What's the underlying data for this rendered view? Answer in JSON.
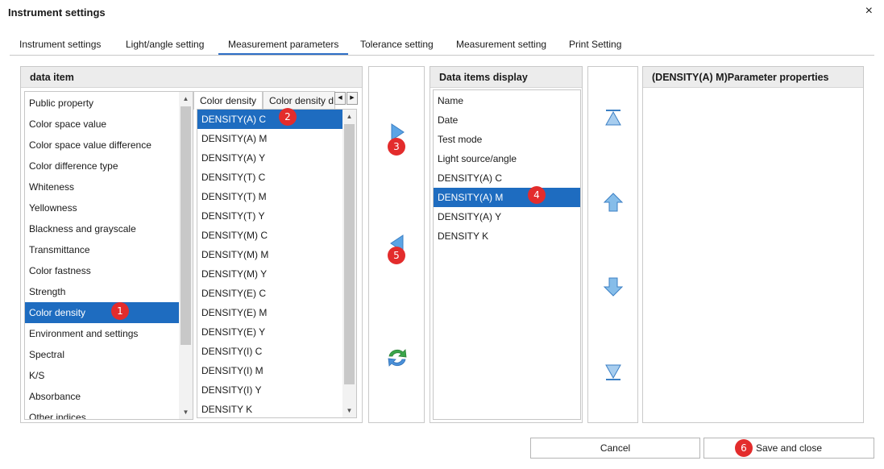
{
  "dialog": {
    "title": "Instrument settings",
    "close_glyph": "×"
  },
  "tabs": [
    {
      "label": "Instrument settings"
    },
    {
      "label": "Light/angle setting"
    },
    {
      "label": "Measurement parameters",
      "active": true
    },
    {
      "label": "Tolerance setting"
    },
    {
      "label": "Measurement setting"
    },
    {
      "label": "Print Setting"
    }
  ],
  "data_item": {
    "header": "data item",
    "categories": [
      "Public property",
      "Color space value",
      "Color space value difference",
      "Color difference type",
      "Whiteness",
      "Yellowness",
      "Blackness and grayscale",
      "Transmittance",
      "Color fastness",
      "Strength",
      "Color density",
      "Environment and settings",
      "Spectral",
      "K/S",
      "Absorbance",
      "Other indices"
    ],
    "selected_category": "Color density",
    "subtabs": [
      {
        "label": "Color density"
      },
      {
        "label": "Color density d"
      }
    ],
    "density_items": [
      "DENSITY(A) C",
      "DENSITY(A) M",
      "DENSITY(A) Y",
      "DENSITY(T) C",
      "DENSITY(T) M",
      "DENSITY(T) Y",
      "DENSITY(M) C",
      "DENSITY(M) M",
      "DENSITY(M) Y",
      "DENSITY(E) C",
      "DENSITY(E) M",
      "DENSITY(E) Y",
      "DENSITY(I) C",
      "DENSITY(I) M",
      "DENSITY(I) Y",
      "DENSITY K"
    ],
    "selected_density": "DENSITY(A) C"
  },
  "display": {
    "header": "Data items display",
    "items": [
      "Name",
      "Date",
      "Test mode",
      "Light source/angle",
      "DENSITY(A) C",
      "DENSITY(A) M",
      "DENSITY(A) Y",
      "DENSITY K"
    ],
    "selected": "DENSITY(A) M"
  },
  "properties": {
    "header": "(DENSITY(A) M)Parameter properties"
  },
  "buttons": {
    "cancel": "Cancel",
    "save": "Save and close"
  },
  "badges": {
    "b1": "1",
    "b2": "2",
    "b3": "3",
    "b4": "4",
    "b5": "5",
    "b6": "6"
  },
  "icons": {
    "add": "arrow-right-icon",
    "remove": "arrow-left-icon",
    "reset": "refresh-icon",
    "top": "move-top-icon",
    "up": "move-up-icon",
    "down": "move-down-icon",
    "bottom": "move-bottom-icon"
  },
  "colors": {
    "accent": "#2e6fc6",
    "selection": "#1e6cc0",
    "badge": "#e32c2c",
    "icon_blue": "#5ba4e5",
    "icon_green": "#3aa64a"
  }
}
